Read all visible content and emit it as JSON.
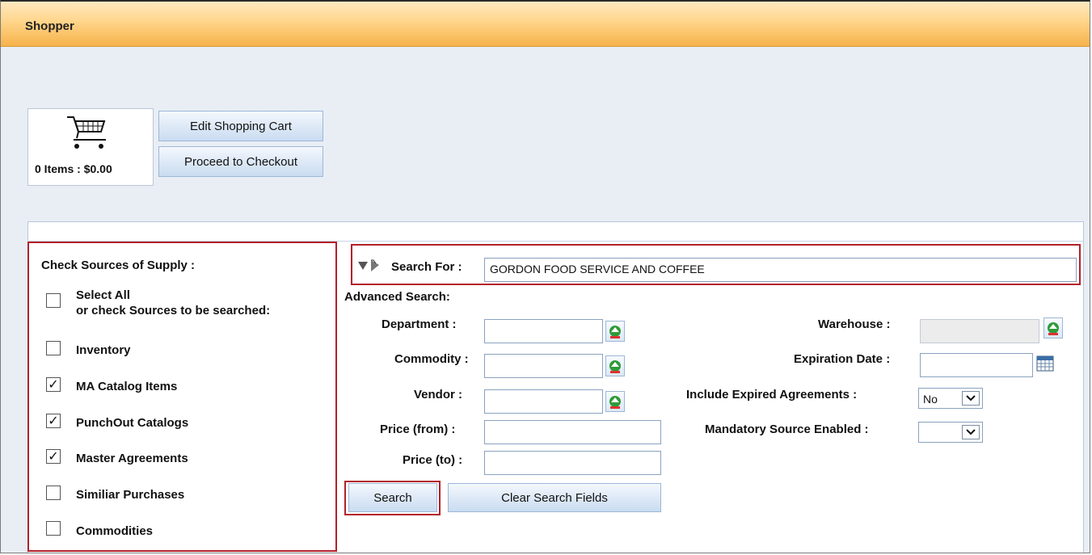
{
  "window": {
    "title": "Shopper"
  },
  "cart": {
    "summary": "0 Items : $0.00",
    "icon": "shopping-cart-icon"
  },
  "buttons": {
    "edit_cart": "Edit Shopping Cart",
    "checkout": "Proceed to Checkout",
    "search": "Search",
    "clear": "Clear Search Fields"
  },
  "sources": {
    "heading": "Check Sources of Supply :",
    "select_all_line1": "Select All",
    "select_all_line2": "or check Sources to be searched:",
    "items": [
      {
        "label": "Inventory",
        "checked": false
      },
      {
        "label": "MA Catalog Items",
        "checked": true
      },
      {
        "label": "PunchOut Catalogs",
        "checked": true
      },
      {
        "label": "Master Agreements",
        "checked": true
      },
      {
        "label": "Similiar Purchases",
        "checked": false
      },
      {
        "label": "Commodities",
        "checked": false
      }
    ],
    "check_mark": "✓"
  },
  "search": {
    "label": "Search For :",
    "value": "GORDON FOOD SERVICE AND COFFEE",
    "toggle_icon": "expand-toggle-icon"
  },
  "advanced": {
    "heading": "Advanced Search:",
    "department": "Department :",
    "commodity": "Commodity :",
    "vendor": "Vendor :",
    "price_from": "Price (from) :",
    "price_to": "Price (to) :",
    "warehouse": "Warehouse :",
    "expiration": "Expiration Date :",
    "include_expired": "Include Expired Agreements :",
    "include_expired_value": "No",
    "mandatory_source": "Mandatory Source Enabled :",
    "mandatory_source_value": ""
  },
  "colors": {
    "highlight": "#b3202a",
    "title_bar": "#f6b24a"
  }
}
